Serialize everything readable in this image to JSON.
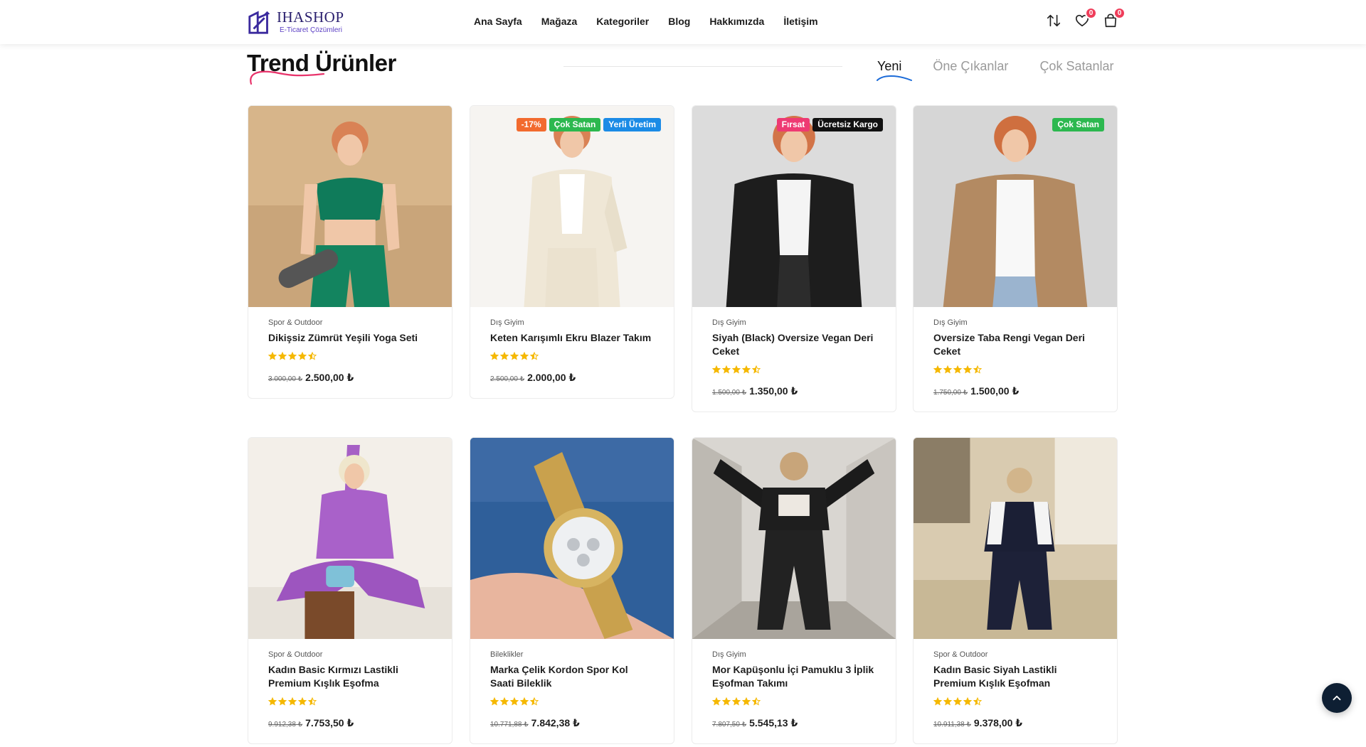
{
  "brand": {
    "name": "IHASHOP",
    "tagline": "E-Ticaret Çözümleri"
  },
  "nav": {
    "items": [
      {
        "label": "Ana Sayfa"
      },
      {
        "label": "Mağaza"
      },
      {
        "label": "Kategoriler"
      },
      {
        "label": "Blog"
      },
      {
        "label": "Hakkımızda"
      },
      {
        "label": "İletişim"
      }
    ]
  },
  "header_icons": {
    "compare_icon": "swap-vertical-icon",
    "wishlist_icon": "heart-icon",
    "wishlist_count": "0",
    "cart_icon": "shopping-bag-icon",
    "cart_count": "0"
  },
  "section": {
    "title": "Trend Ürünler",
    "tabs": [
      {
        "label": "Yeni",
        "active": true
      },
      {
        "label": "Öne Çıkanlar",
        "active": false
      },
      {
        "label": "Çok Satanlar",
        "active": false
      }
    ]
  },
  "colors": {
    "accent_pink": "#e8336b",
    "accent_blue": "#1a6ad8",
    "star": "#f5b800",
    "badge_orange": "#f26a2e",
    "badge_green": "#2cb84f",
    "badge_blue": "#1b8be6",
    "badge_pink": "#ee3a73",
    "badge_black": "#111111"
  },
  "products": [
    {
      "category": "Spor & Outdoor",
      "name": "Dikişsiz Zümrüt Yeşili Yoga Seti",
      "rating": 4.5,
      "old_price": "3.000,00 ₺",
      "price": "2.500,00 ₺",
      "badges": []
    },
    {
      "category": "Dış Giyim",
      "name": "Keten Karışımlı Ekru Blazer Takım",
      "rating": 4.5,
      "old_price": "2.500,00 ₺",
      "price": "2.000,00 ₺",
      "badges": [
        {
          "label": "-17%",
          "color": "#f26a2e"
        },
        {
          "label": "Çok Satan",
          "color": "#2cb84f"
        },
        {
          "label": "Yerli Üretim",
          "color": "#1b8be6"
        }
      ]
    },
    {
      "category": "Dış Giyim",
      "name": "Siyah (Black) Oversize Vegan Deri Ceket",
      "rating": 4.5,
      "old_price": "1.500,00 ₺",
      "price": "1.350,00 ₺",
      "badges": [
        {
          "label": "Fırsat",
          "color": "#ee3a73"
        },
        {
          "label": "Ücretsiz Kargo",
          "color": "#111111"
        }
      ]
    },
    {
      "category": "Dış Giyim",
      "name": "Oversize Taba Rengi Vegan Deri Ceket",
      "rating": 4.5,
      "old_price": "1.750,00 ₺",
      "price": "1.500,00 ₺",
      "badges": [
        {
          "label": "Çok Satan",
          "color": "#2cb84f"
        }
      ]
    },
    {
      "category": "Spor & Outdoor",
      "name": "Kadın Basic Kırmızı Lastikli Premium Kışlık Eşofma",
      "rating": 4.5,
      "old_price": "9.912,38 ₺",
      "price": "7.753,50 ₺",
      "badges": []
    },
    {
      "category": "Bileklikler",
      "name": "Marka Çelik Kordon Spor Kol Saati Bileklik",
      "rating": 4.5,
      "old_price": "10.771,88 ₺",
      "price": "7.842,38 ₺",
      "badges": []
    },
    {
      "category": "Dış Giyim",
      "name": "Mor Kapüşonlu İçi Pamuklu 3 İplik Eşofman Takımı",
      "rating": 4.5,
      "old_price": "7.807,50 ₺",
      "price": "5.545,13 ₺",
      "badges": []
    },
    {
      "category": "Spor & Outdoor",
      "name": "Kadın Basic Siyah Lastikli Premium Kışlık Eşofman",
      "rating": 4.5,
      "old_price": "10.911,38 ₺",
      "price": "9.378,00 ₺",
      "badges": []
    }
  ],
  "scroll_top_icon": "chevron-up-icon"
}
